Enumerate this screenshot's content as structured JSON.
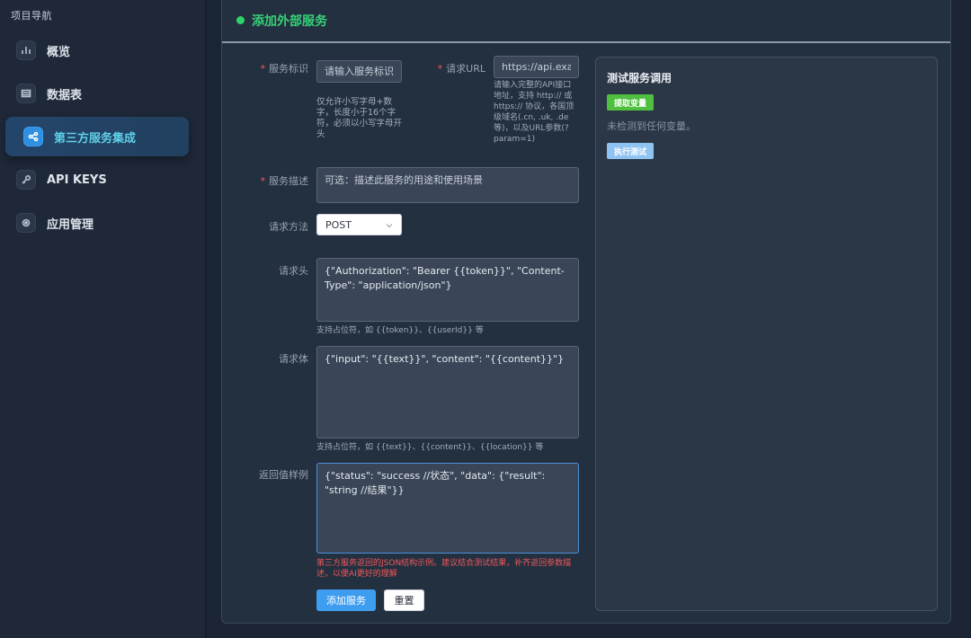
{
  "sidebar": {
    "title": "项目导航",
    "items": [
      {
        "label": "概览",
        "icon": "bar-chart-icon"
      },
      {
        "label": "数据表",
        "icon": "table-icon"
      },
      {
        "label": "第三方服务集成",
        "icon": "share-icon"
      },
      {
        "label": "API KEYS",
        "icon": "key-icon"
      },
      {
        "label": "应用管理",
        "icon": "settings-icon"
      }
    ],
    "active_index": 2
  },
  "panel": {
    "title": "添加外部服务"
  },
  "form": {
    "service_id": {
      "label": "服务标识",
      "placeholder": "请输入服务标识,",
      "hint": "仅允许小写字母+数字，长度小于16个字符，必须以小写字母开头"
    },
    "request_url": {
      "label": "请求URL",
      "placeholder": "https://api.exam",
      "hint": "请输入完整的API接口地址，支持 http:// 或 https:// 协议，各国顶级域名(.cn, .uk, .de 等)，以及URL参数(?param=1)"
    },
    "description": {
      "label": "服务描述",
      "placeholder": "可选：描述此服务的用途和使用场景"
    },
    "method": {
      "label": "请求方法",
      "value": "POST"
    },
    "headers": {
      "label": "请求头",
      "value": "{\"Authorization\": \"Bearer {{token}}\", \"Content-Type\": \"application/json\"}",
      "hint": "支持占位符，如 {{token}}、{{userId}} 等"
    },
    "body": {
      "label": "请求体",
      "value": "{\"input\": \"{{text}}\", \"content\": \"{{content}}\"}",
      "hint": "支持占位符，如 {{text}}、{{content}}、{{location}} 等"
    },
    "response_example": {
      "label": "返回值样例",
      "value": "{\"status\": \"success //状态\", \"data\": {\"result\": \"string //结果\"}}",
      "hint": "第三方服务返回的JSON结构示例。建议结合测试结果，补齐返回参数描述，以便AI更好的理解"
    },
    "submit_label": "添加服务",
    "reset_label": "重置"
  },
  "test_panel": {
    "title": "测试服务调用",
    "extract_label": "提取变量",
    "empty_text": "未检测到任何变量。",
    "run_label": "执行测试"
  }
}
